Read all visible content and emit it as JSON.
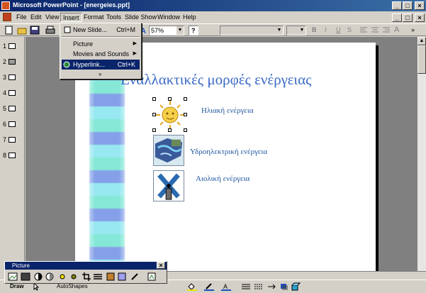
{
  "window": {
    "title": "Microsoft PowerPoint - [energeies.ppt]"
  },
  "menu": [
    "File",
    "Edit",
    "View",
    "Insert",
    "Format",
    "Tools",
    "Slide Show",
    "Window",
    "Help"
  ],
  "toolbar": {
    "zoom": "57%",
    "help_glyph": "?",
    "bold": "B",
    "italic": "I",
    "underline": "U",
    "shadow": "S",
    "font_grow": "A"
  },
  "insert_menu": {
    "new_slide": {
      "label": "New Slide...",
      "shortcut": "Ctrl+M"
    },
    "picture": {
      "label": "Picture"
    },
    "movies": {
      "label": "Movies and Sounds"
    },
    "hyperlink": {
      "label": "Hyperlink...",
      "shortcut": "Ctrl+K"
    },
    "more": "»"
  },
  "slides": [
    "1",
    "2",
    "3",
    "4",
    "5",
    "6",
    "7",
    "8"
  ],
  "slide": {
    "title": "Εναλλακτικές μορφές ενέργειας",
    "items": [
      "Ηλιακή ενέργεια",
      "Υδροηλεκτρική ενέργεια",
      "Αιολική ενέργεια"
    ]
  },
  "picture_toolbar": {
    "title": "Picture"
  },
  "drawing_toolbar": {
    "draw": "Draw",
    "autoshapes": "AutoShapes"
  },
  "colors": {
    "title_blue": "#3b6bc7",
    "item_blue": "#1f55a0",
    "titlebar": "#0a246a"
  }
}
